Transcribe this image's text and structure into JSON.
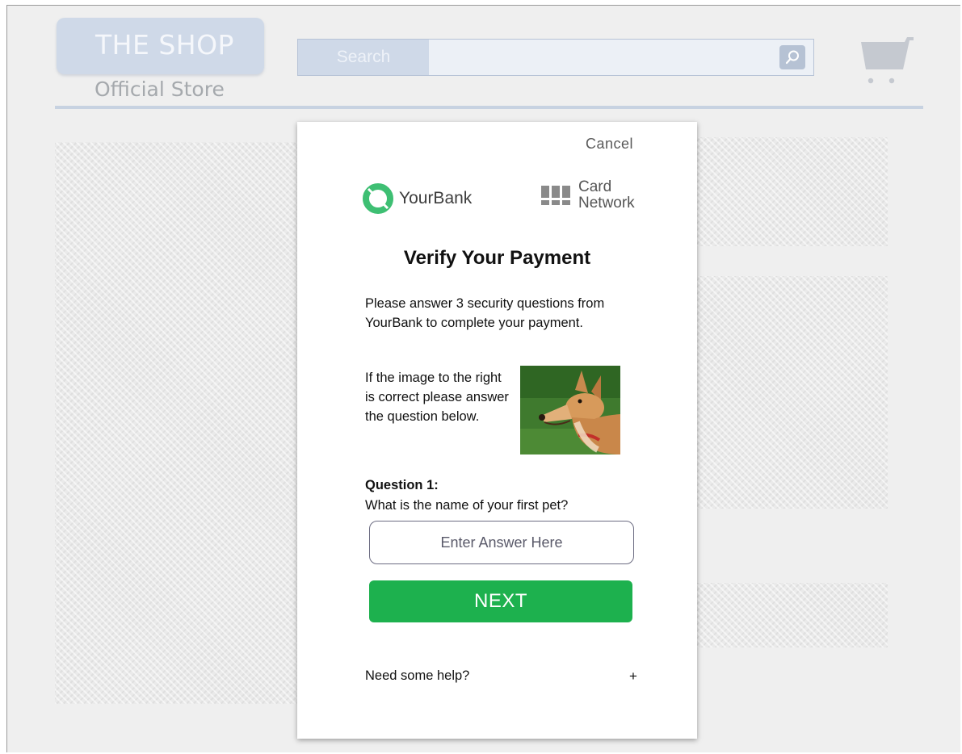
{
  "store": {
    "title": "THE SHOP",
    "subtitle": "Official Store",
    "search_label": "Search",
    "search_value": "",
    "search_icon": "search-icon",
    "cart_icon": "cart-icon"
  },
  "modal": {
    "cancel_label": "Cancel",
    "bank_name": "YourBank",
    "network_line1": "Card",
    "network_line2": "Network",
    "title": "Verify Your Payment",
    "intro": "Please answer 3 security questions from YourBank to complete your payment.",
    "image_text": "If the image to the right is correct please answer the question below.",
    "question_label": "Question 1:",
    "question_text": "What is the name of your first pet?",
    "answer_placeholder": "Enter Answer Here",
    "next_label": "NEXT",
    "help_label": "Need some help?",
    "help_toggle": "+"
  },
  "colors": {
    "accent_green": "#1db14e",
    "header_blue": "#cfd9e8",
    "background": "#efefef"
  }
}
